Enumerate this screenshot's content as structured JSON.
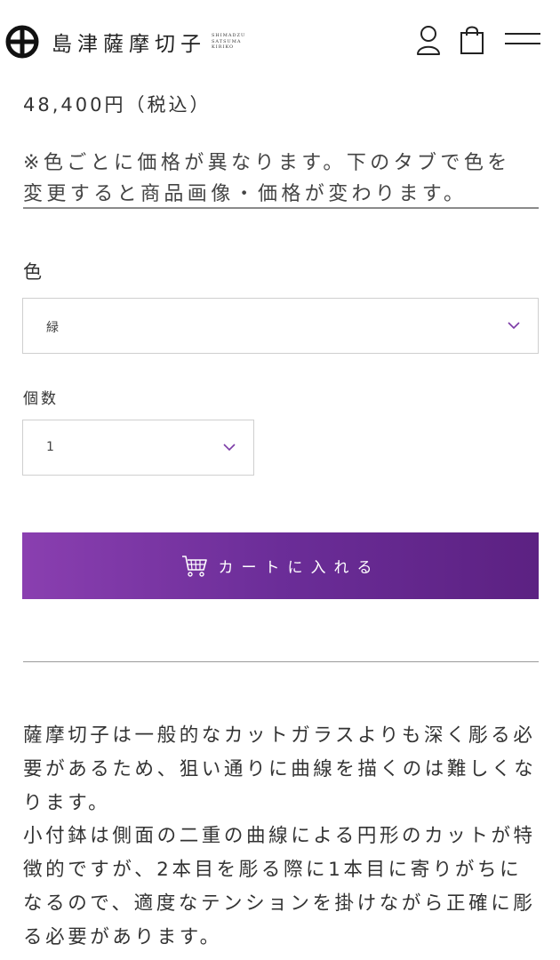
{
  "header": {
    "logo_text": "島津薩摩切子",
    "logo_sub_1": "SHIMADZU",
    "logo_sub_2": "SATSUMA",
    "logo_sub_3": "KIRIKO",
    "icons": [
      "brand-mark-icon",
      "user-icon",
      "shopping-bag-icon",
      "hamburger-menu-icon"
    ]
  },
  "product": {
    "price": "48,400円（税込）",
    "notice_line1": "※色ごとに価格が異なります。下のタブで色を",
    "notice_line2": "変更すると商品画像・価格が変わります。"
  },
  "options": {
    "color_label": "色",
    "color_value": "緑",
    "quantity_label": "個数",
    "quantity_value": "1"
  },
  "cart": {
    "button_label": "カートに入れる",
    "button_color": "#6b2d98"
  },
  "description": {
    "paragraph1": "薩摩切子は一般的なカットガラスよりも深く彫る必要があるため、狙い通りに曲線を描くのは難しくなります。",
    "paragraph2": "小付鉢は側面の二重の曲線による円形のカットが特徴的ですが、2本目を彫る際に1本目に寄りがちになるので、適度なテンションを掛けながら正確に彫る必要があります。"
  }
}
